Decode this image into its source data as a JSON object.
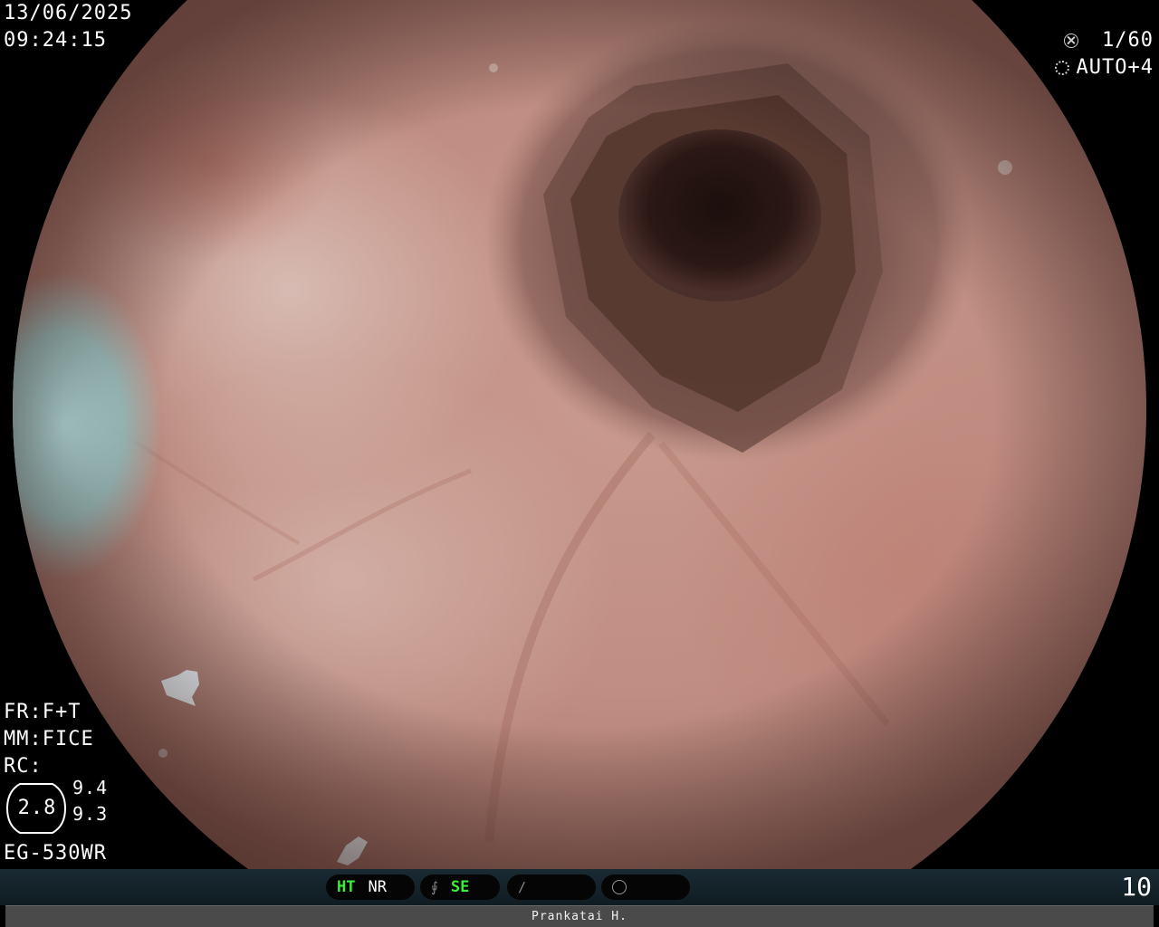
{
  "overlay": {
    "date": "13/06/2025",
    "time": "09:24:15",
    "shutter": "1/60",
    "iris": "AUTO+4",
    "fr": "FR:F+T",
    "mm": "MM:FICE",
    "rc": "RC:",
    "zoom": "2.8",
    "zoom_side_top": "9.4",
    "zoom_side_bottom": "9.3",
    "scope_model": "EG-530WR"
  },
  "status_bar": {
    "ht": "HT",
    "nr": "NR",
    "se": "SE",
    "page": "10"
  },
  "patient": {
    "name": "Prankatai H."
  },
  "icons": {
    "shutter": "shutter-icon",
    "iris": "iris-icon",
    "tone": "tone-curve-icon",
    "freeze": "freeze-icon",
    "mode": "mode-circle-icon"
  }
}
